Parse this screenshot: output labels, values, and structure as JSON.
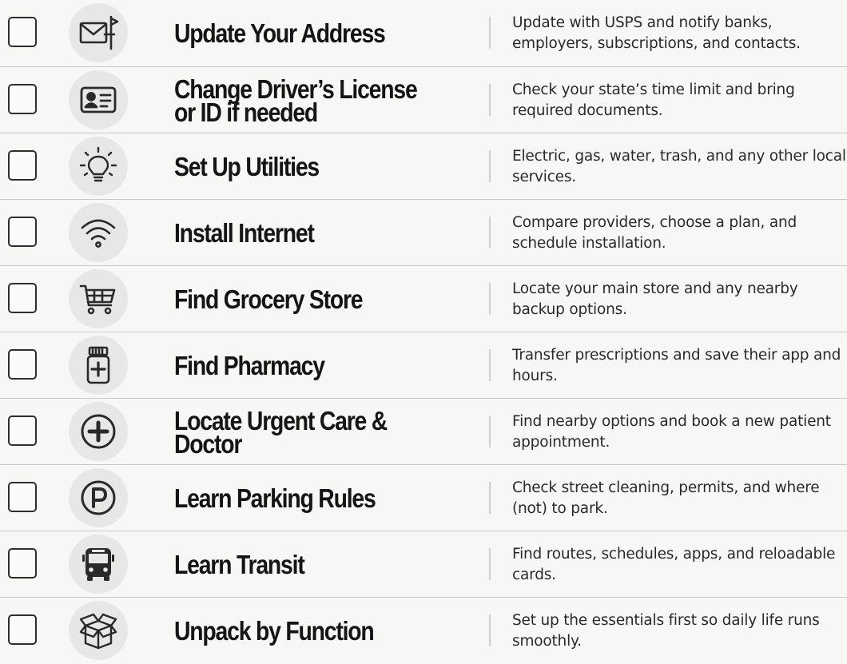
{
  "checklist": {
    "items": [
      {
        "title": "Update Your Address",
        "icon": "envelope-icon",
        "desc": "Update with USPS and notify banks, employers, subscriptions, and contacts."
      },
      {
        "title": "Change Driver’s License\nor ID if needed",
        "icon": "id-card-icon",
        "desc": "Check your state’s time limit and bring required documents."
      },
      {
        "title": "Set Up Utilities",
        "icon": "lightbulb-icon",
        "desc": "Electric, gas, water, trash, and any other local services."
      },
      {
        "title": "Install Internet",
        "icon": "wifi-icon",
        "desc": "Compare providers, choose a plan, and schedule installation."
      },
      {
        "title": "Find Grocery Store",
        "icon": "shopping-cart-icon",
        "desc": "Locate your main store and any nearby backup options."
      },
      {
        "title": "Find Pharmacy",
        "icon": "pill-bottle-icon",
        "desc": "Transfer prescriptions and save their app and hours."
      },
      {
        "title": "Locate Urgent Care & Doctor",
        "icon": "medical-plus-icon",
        "desc": "Find nearby options and book a new patient appointment."
      },
      {
        "title": "Learn Parking Rules",
        "icon": "parking-icon",
        "desc": "Check street cleaning, permits, and where (not) to park."
      },
      {
        "title": "Learn Transit",
        "icon": "bus-icon",
        "desc": "Find routes, schedules, apps, and reloadable cards."
      },
      {
        "title": "Unpack by Function",
        "icon": "open-box-icon",
        "desc": "Set up the essentials first so daily life runs smoothly."
      }
    ]
  }
}
